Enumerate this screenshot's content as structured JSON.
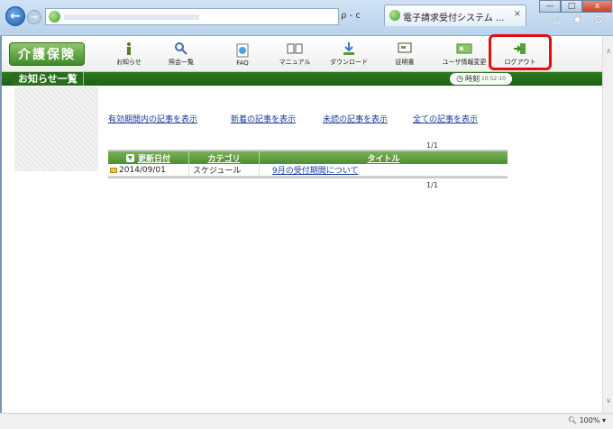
{
  "browser": {
    "tab_title": "電子請求受付システム ...",
    "tab_close": "×",
    "address_tools": "ρ - c",
    "window_min": "—",
    "window_max": "□",
    "window_close": "x",
    "right_icons": "⌂ ★ ⚙"
  },
  "app": {
    "logo": "介護保険",
    "menu": [
      {
        "label": "お知らせ",
        "icon": "info-icon"
      },
      {
        "label": "照会一覧",
        "icon": "search-list-icon"
      },
      {
        "label": "FAQ",
        "icon": "faq-icon"
      },
      {
        "label": "マニュアル",
        "icon": "manual-icon"
      },
      {
        "label": "ダウンロード",
        "icon": "download-icon"
      },
      {
        "label": "証明書",
        "icon": "certificate-icon"
      },
      {
        "label": "ユーザ情報変更",
        "icon": "user-info-icon"
      },
      {
        "label": "ログアウト",
        "icon": "logout-icon"
      }
    ]
  },
  "page": {
    "title": "お知らせ一覧",
    "clock_label": "時刻",
    "clock_value": "10:52:10"
  },
  "filters": [
    "有効期間内の記事を表示",
    "新着の記事を表示",
    "未読の記事を表示",
    "全ての記事を表示"
  ],
  "table": {
    "pager_top": "1/1",
    "pager_bottom": "1/1",
    "headers": {
      "date": "更新日付",
      "category": "カテゴリ",
      "title": "タイトル"
    },
    "rows": [
      {
        "date": "2014/09/01",
        "category": "スケジュール",
        "title": "9月の受付期間について"
      }
    ]
  },
  "status": {
    "zoom": "100%"
  },
  "colors": {
    "accent_green": "#3f8a2a",
    "link_blue": "#1a3a9c",
    "highlight_red": "#e01010"
  }
}
